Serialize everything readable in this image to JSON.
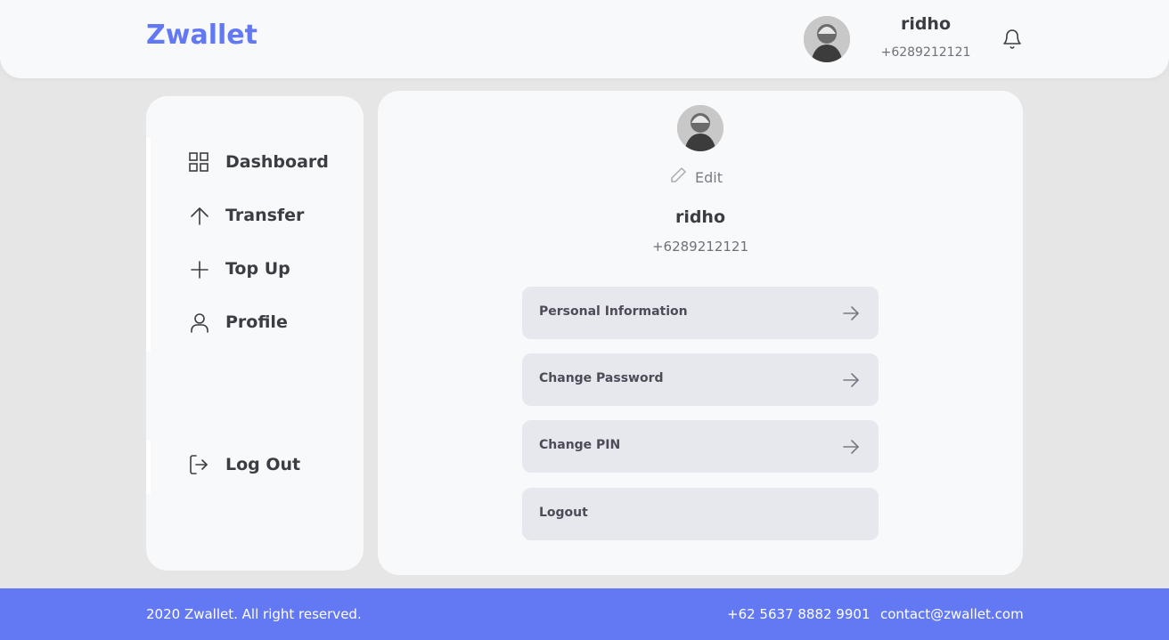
{
  "header": {
    "logo": "Zwallet",
    "user_name": "ridho",
    "user_phone": "+6289212121",
    "icons": {
      "notification": "bell-icon",
      "avatar": "avatar"
    }
  },
  "sidebar": {
    "items": [
      {
        "label": "Dashboard",
        "icon": "grid-icon"
      },
      {
        "label": "Transfer",
        "icon": "arrow-up-icon"
      },
      {
        "label": "Top Up",
        "icon": "plus-icon"
      },
      {
        "label": "Profile",
        "icon": "user-icon"
      }
    ],
    "logout": {
      "label": "Log Out",
      "icon": "log-out-icon"
    }
  },
  "profile": {
    "edit_label": "Edit",
    "name": "ridho",
    "phone": "+6289212121",
    "menu": [
      {
        "label": "Personal Information",
        "has_arrow": true
      },
      {
        "label": "Change Password",
        "has_arrow": true
      },
      {
        "label": "Change PIN",
        "has_arrow": true
      },
      {
        "label": "Logout",
        "has_arrow": false
      }
    ]
  },
  "footer": {
    "copyright": "2020 Zwallet. All right reserved.",
    "phone": "+62 5637 8882 9901",
    "email": "contact@zwallet.com"
  },
  "colors": {
    "brand": "#6379f4",
    "background": "#e6e6e6",
    "panel": "#f8f9fb",
    "button": "#e6e8ed",
    "text": "#3a3d42"
  }
}
